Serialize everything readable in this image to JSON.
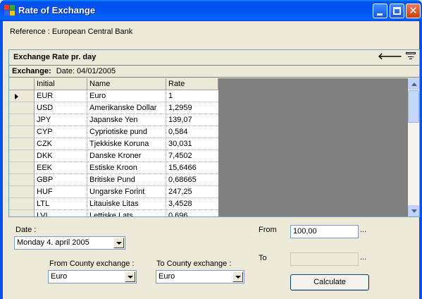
{
  "window": {
    "title": "Rate of Exchange"
  },
  "reference": "Reference : European Central Bank",
  "grid": {
    "caption": "Exchange Rate pr. day",
    "parent_table": "Exchange:",
    "parent_date": "Date:   04/01/2005",
    "columns": [
      "Initial",
      "Name",
      "Rate"
    ],
    "rows": [
      {
        "initial": "EUR",
        "name": "Euro",
        "rate": "1"
      },
      {
        "initial": "USD",
        "name": "Amerikanske Dollar",
        "rate": "1,2959"
      },
      {
        "initial": "JPY",
        "name": "Japanske Yen",
        "rate": "139,07"
      },
      {
        "initial": "CYP",
        "name": "Cypriotiske pund",
        "rate": "0,584"
      },
      {
        "initial": "CZK",
        "name": "Tjekkiske Koruna",
        "rate": "30,031"
      },
      {
        "initial": "DKK",
        "name": "Danske Kroner",
        "rate": "7,4502"
      },
      {
        "initial": "EEK",
        "name": "Estiske Kroon",
        "rate": "15,6466"
      },
      {
        "initial": "GBP",
        "name": "Britiske Pund",
        "rate": "0,68665"
      },
      {
        "initial": "HUF",
        "name": "Ungarske Forint",
        "rate": "247,25"
      },
      {
        "initial": "LTL",
        "name": "Litauiske Litas",
        "rate": "3,4528"
      },
      {
        "initial": "LVL",
        "name": "Lettiske Lats",
        "rate": "0,696"
      }
    ]
  },
  "form": {
    "date_label": "Date :",
    "date_value": "Monday 4. april 2005",
    "from_country_label": "From County exchange :",
    "from_country_value": "Euro",
    "to_country_label": "To County exchange :",
    "to_country_value": "Euro",
    "from_label": "From",
    "from_value": "100,00",
    "from_suffix": "...",
    "to_label": "To",
    "to_value": "",
    "to_suffix": "...",
    "calculate_label": "Calculate"
  },
  "icons": {
    "navigate_back": "left-arrow-icon",
    "toggle_parent_rows": "parent-rows-toggle-icon",
    "current_row": "row-pointer-icon"
  }
}
